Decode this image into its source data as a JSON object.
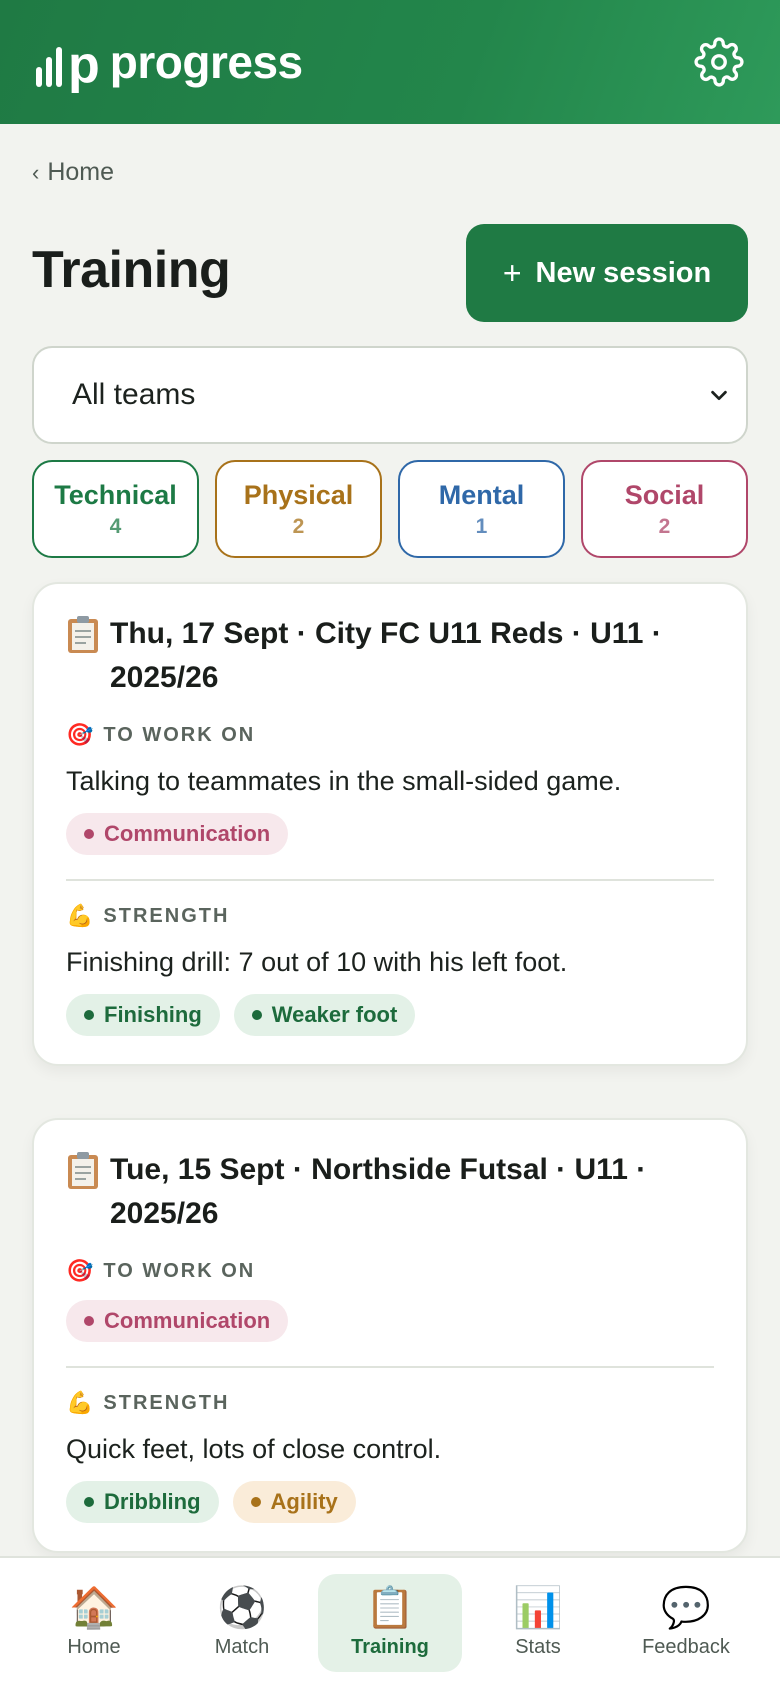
{
  "header": {
    "brand_letter": "p",
    "brand_name": "progress",
    "settings_icon": "gear-icon"
  },
  "breadcrumb": {
    "back_label": "Home"
  },
  "page": {
    "title": "Training",
    "new_session_label": "New session"
  },
  "team_filter": {
    "selected": "All teams"
  },
  "categories": [
    {
      "name": "Technical",
      "count": "4",
      "color": "#1d7a45"
    },
    {
      "name": "Physical",
      "count": "2",
      "color": "#a8721a"
    },
    {
      "name": "Mental",
      "count": "1",
      "color": "#2f68a8"
    },
    {
      "name": "Social",
      "count": "2",
      "color": "#b0476a"
    }
  ],
  "sessions": [
    {
      "title": "Thu, 17 Sept · City FC U11 Reds · U11 · 2025/26",
      "work_on_label": "TO WORK ON",
      "work_on_note": "Talking to teammates in the small-sided game.",
      "work_on_tags": [
        "Communication"
      ],
      "strength_label": "STRENGTH",
      "strength_note": "Finishing drill: 7 out of 10 with his left foot.",
      "strength_tags": [
        "Finishing",
        "Weaker foot"
      ]
    },
    {
      "title": "Tue, 15 Sept · Northside Futsal · U11 · 2025/26",
      "work_on_label": "TO WORK ON",
      "work_on_tags": [
        "Communication"
      ],
      "strength_label": "STRENGTH",
      "strength_note": "Quick feet, lots of close control.",
      "strength_tags": [
        "Dribbling",
        "Agility"
      ]
    }
  ],
  "nav": [
    {
      "label": "Home",
      "icon": "house-icon",
      "glyph": "🏠"
    },
    {
      "label": "Match",
      "icon": "soccer-ball-icon",
      "glyph": "⚽"
    },
    {
      "label": "Training",
      "icon": "clipboard-icon",
      "glyph": "📋",
      "active": true
    },
    {
      "label": "Stats",
      "icon": "bar-chart-icon",
      "glyph": "📊"
    },
    {
      "label": "Feedback",
      "icon": "speech-bubble-icon",
      "glyph": "💬"
    }
  ]
}
